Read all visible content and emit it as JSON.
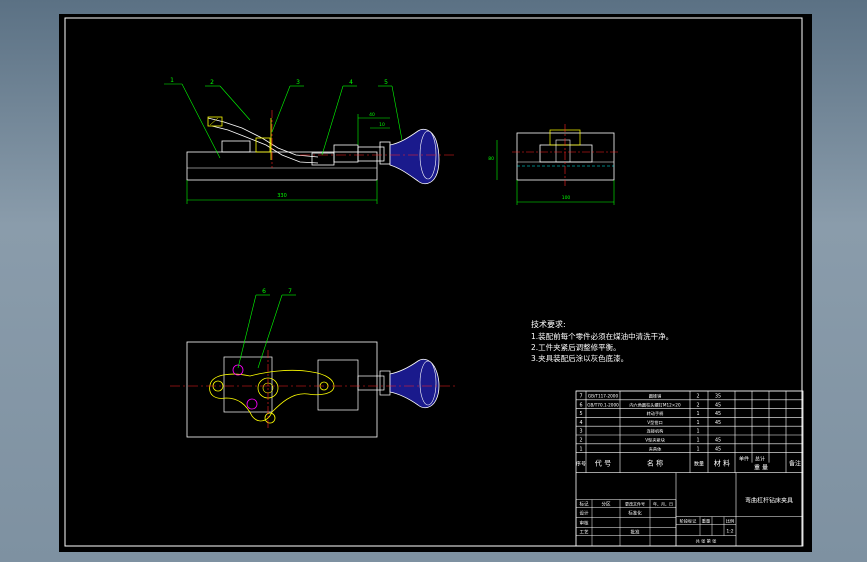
{
  "colors": {
    "background": "#6e8292",
    "sheet": "#000000",
    "border": "#ffffff",
    "part_lines": "#ffffff",
    "dimension": "#00ff00",
    "center_line": "#ff2020",
    "hidden_line": "#00ffff",
    "handle_fill": "#1a1a8c",
    "handle_accent": "#ffff00",
    "hatch": "#ff00ff"
  },
  "balloons": [
    "1",
    "2",
    "3",
    "4",
    "5",
    "6",
    "7"
  ],
  "dimensions": {
    "front_length": "330",
    "front_small_1": "40",
    "front_small_2": "10",
    "side_height": "80",
    "side_width": "100"
  },
  "tech_requirements": {
    "title": "技术要求:",
    "items": [
      "1.装配前每个零件必须在煤油中清洗干净。",
      "2.工件夹紧后调整修平衡。",
      "3.夹具装配后涂以灰色底漆。"
    ]
  },
  "bom": {
    "rows": [
      {
        "no": "7",
        "code": "GB/T117-2000",
        "name": "圆锥销",
        "qty": "2",
        "material": "35"
      },
      {
        "no": "6",
        "code": "GB/T70.1-2000",
        "name": "内六角圆柱头螺钉M12×20",
        "qty": "2",
        "material": "45"
      },
      {
        "no": "5",
        "code": "",
        "name": "转动手柄",
        "qty": "1",
        "material": "45"
      },
      {
        "no": "4",
        "code": "",
        "name": "V型钳口",
        "qty": "1",
        "material": "45"
      },
      {
        "no": "3",
        "code": "",
        "name": "连接机构",
        "qty": "1",
        "material": ""
      },
      {
        "no": "2",
        "code": "",
        "name": "V型夹紧块",
        "qty": "1",
        "material": "45"
      },
      {
        "no": "1",
        "code": "",
        "name": "夹具体",
        "qty": "1",
        "material": "45"
      }
    ],
    "header": {
      "no": "序号",
      "code": "代 号",
      "name": "名 称",
      "qty": "数量",
      "material": "材 料",
      "weight_unit": "单件",
      "weight_total": "总计",
      "weight": "重 量",
      "remark": "备注"
    }
  },
  "title_block": {
    "drawing_title": "弯曲杠杆钻床夹具",
    "scale_value": "1:2",
    "cells": {
      "mark": "标记",
      "zones": "处数",
      "zone": "分区",
      "change_doc": "更改文件号",
      "signature": "签名",
      "date": "年、月、日",
      "design": "设计",
      "standardize": "标准化",
      "stage_mark": "阶段标记",
      "weight": "重量",
      "scale": "比例",
      "review": "审核",
      "process": "工艺",
      "approve": "批准",
      "sheets": "共  张  第  张"
    }
  }
}
